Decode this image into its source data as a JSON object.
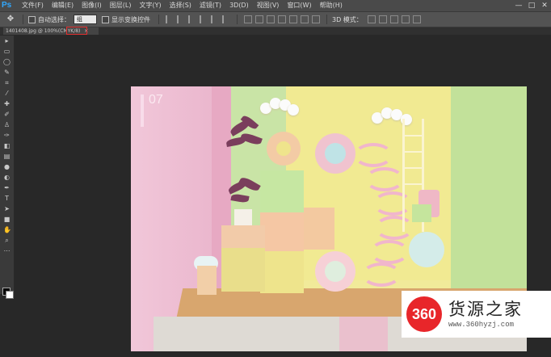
{
  "app": {
    "logo": "Ps",
    "window_controls": [
      "—",
      "□",
      "✕"
    ]
  },
  "menubar": {
    "items": [
      "文件(F)",
      "编辑(E)",
      "图像(I)",
      "图层(L)",
      "文字(Y)",
      "选择(S)",
      "滤镜(T)",
      "3D(D)",
      "视图(V)",
      "窗口(W)",
      "帮助(H)"
    ]
  },
  "options_bar": {
    "tool_icon": "move-tool-icon",
    "auto_select_label": "自动选择：",
    "auto_select_value": "组",
    "show_transform_label": "显示变换控件",
    "mode_label": "3D 模式："
  },
  "document_tab": {
    "title": "1401408.jpg @ 100%(CMYK/8)",
    "close": "×"
  },
  "photo": {
    "number": "07"
  },
  "watermark": {
    "logo_text": "360",
    "title": "货源之家",
    "url": "www.360hyzj.com",
    "accent": "#e8262a"
  }
}
